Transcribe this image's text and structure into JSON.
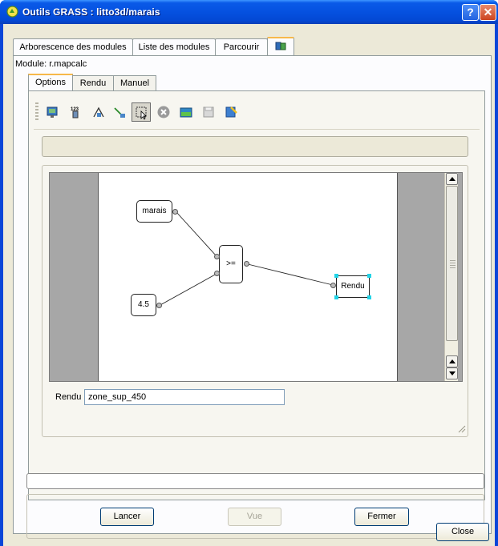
{
  "window": {
    "title": "Outils GRASS : litto3d/marais",
    "help_label": "?",
    "close_label": "✕"
  },
  "top_tabs": [
    {
      "label": "Arborescence des modules"
    },
    {
      "label": "Liste des modules"
    },
    {
      "label": "Parcourir"
    },
    {
      "icon": "module-icon"
    }
  ],
  "module": {
    "label": "Module: r.mapcalc"
  },
  "sub_tabs": [
    {
      "label": "Options"
    },
    {
      "label": "Rendu"
    },
    {
      "label": "Manuel"
    }
  ],
  "toolbar": {
    "tools": [
      "add-map-icon",
      "add-constant-icon",
      "add-operator-icon",
      "add-connection-icon",
      "select-icon",
      "delete-icon",
      "load-icon",
      "save-icon",
      "clear-icon"
    ],
    "active_tool": "select-icon"
  },
  "diagram": {
    "nodes": [
      {
        "id": "marais",
        "label": "marais"
      },
      {
        "id": "const",
        "label": "4.5"
      },
      {
        "id": "op",
        "label": ">="
      },
      {
        "id": "out",
        "label": "Rendu"
      }
    ]
  },
  "output": {
    "label": "Rendu",
    "value": "zone_sup_450"
  },
  "buttons": {
    "run": "Lancer",
    "view": "Vue",
    "close_inner": "Fermer",
    "close": "Close"
  },
  "colors": {
    "titlebar": "#0551e0",
    "selection": "#22d3e6",
    "tab_highlight": "#f7b84a"
  }
}
